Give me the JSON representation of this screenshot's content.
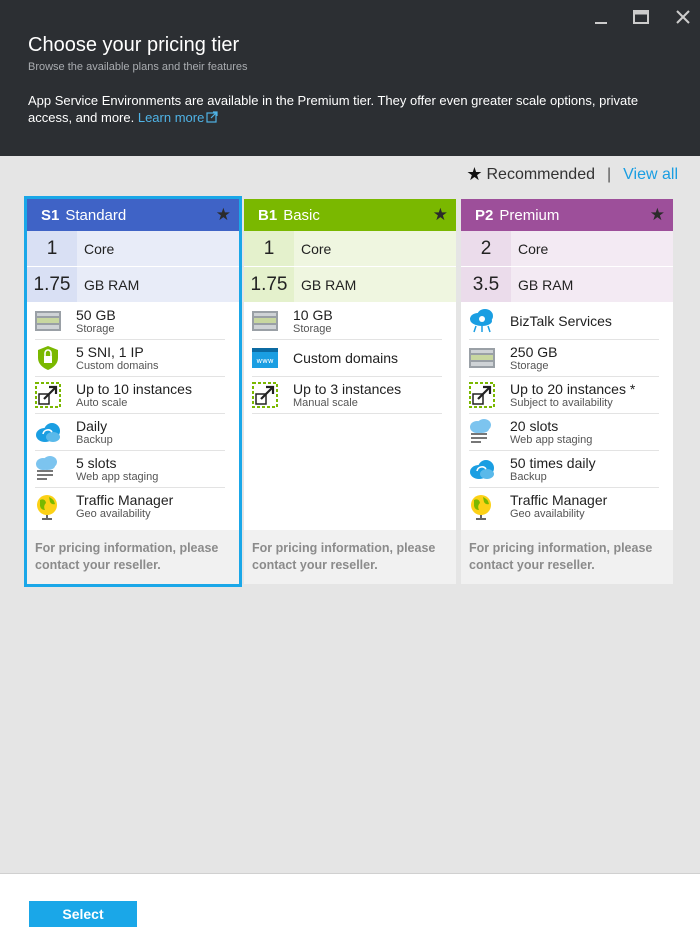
{
  "header": {
    "title": "Choose your pricing tier",
    "subtitle": "Browse the available plans and their features",
    "description": "App Service Environments are available in the Premium tier. They offer even greater scale options, private access, and more.",
    "learn_more": "Learn more"
  },
  "toolbar": {
    "recommended_label": "Recommended",
    "separator": "|",
    "view_all": "View all"
  },
  "tiers": [
    {
      "code": "S1",
      "name": "Standard",
      "color": "#3f63c6",
      "core": "1",
      "core_label": "Core",
      "ram": "1.75",
      "ram_label": "GB RAM",
      "features": [
        {
          "icon": "storage-icon",
          "main": "50 GB",
          "sub": "Storage"
        },
        {
          "icon": "ssl-lock-icon",
          "main": "5 SNI, 1 IP",
          "sub": "Custom domains"
        },
        {
          "icon": "scale-icon",
          "main": "Up to 10 instances",
          "sub": "Auto scale"
        },
        {
          "icon": "backup-cloud-icon",
          "main": "Daily",
          "sub": "Backup"
        },
        {
          "icon": "staging-slots-icon",
          "main": "5 slots",
          "sub": "Web app staging"
        },
        {
          "icon": "globe-icon",
          "main": "Traffic Manager",
          "sub": "Geo availability"
        }
      ],
      "note": "For pricing information, please contact your reseller."
    },
    {
      "code": "B1",
      "name": "Basic",
      "color": "#7ab800",
      "core": "1",
      "core_label": "Core",
      "ram": "1.75",
      "ram_label": "GB RAM",
      "features": [
        {
          "icon": "storage-icon",
          "main": "10 GB",
          "sub": "Storage"
        },
        {
          "icon": "www-icon",
          "main": "Custom domains",
          "sub": ""
        },
        {
          "icon": "scale-icon",
          "main": "Up to 3 instances",
          "sub": "Manual scale"
        }
      ],
      "note": "For pricing information, please contact your reseller."
    },
    {
      "code": "P2",
      "name": "Premium",
      "color": "#9d4f9a",
      "core": "2",
      "core_label": "Core",
      "ram": "3.5",
      "ram_label": "GB RAM",
      "features": [
        {
          "icon": "biztalk-icon",
          "main": "BizTalk Services",
          "sub": ""
        },
        {
          "icon": "storage-icon",
          "main": "250 GB",
          "sub": "Storage"
        },
        {
          "icon": "scale-icon",
          "main": "Up to 20 instances *",
          "sub": "Subject to availability"
        },
        {
          "icon": "staging-slots-icon",
          "main": "20 slots",
          "sub": "Web app staging"
        },
        {
          "icon": "backup-cloud-icon",
          "main": "50 times daily",
          "sub": "Backup"
        },
        {
          "icon": "globe-icon",
          "main": "Traffic Manager",
          "sub": "Geo availability"
        }
      ],
      "note": "For pricing information, please contact your reseller."
    }
  ],
  "footer": {
    "select_label": "Select"
  }
}
